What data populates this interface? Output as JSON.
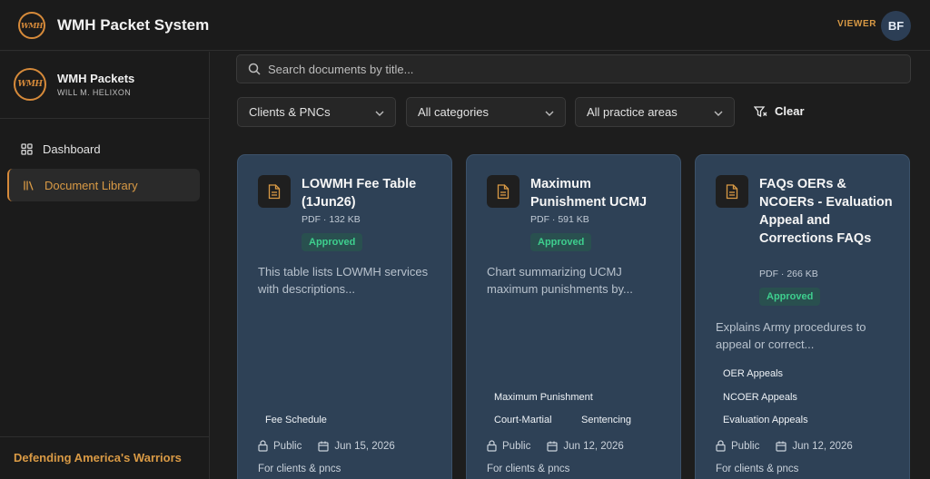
{
  "header": {
    "logo_text": "WMH",
    "app_title": "WMH Packet System",
    "role": "VIEWER",
    "avatar_initials": "BF"
  },
  "sidebar": {
    "brand_name": "WMH Packets",
    "brand_sub": "WILL M. HELIXON",
    "items": [
      {
        "label": "Dashboard",
        "icon": "grid-icon",
        "active": false
      },
      {
        "label": "Document Library",
        "icon": "library-icon",
        "active": true
      }
    ],
    "tagline": "Defending America's Warriors"
  },
  "search": {
    "placeholder": "Search documents by title..."
  },
  "filters": {
    "audience": "Clients & PNCs",
    "category": "All categories",
    "practice_area": "All practice areas",
    "clear_label": "Clear"
  },
  "documents": [
    {
      "title": "LOWMH Fee Table (1Jun26)",
      "meta": "PDF · 132 KB",
      "status": "Approved",
      "description": "This table lists LOWMH services with descriptions...",
      "tags": [
        "Fee Schedule"
      ],
      "visibility": "Public",
      "date": "Jun 15, 2026",
      "audience": "For clients & pncs"
    },
    {
      "title": "Maximum Punishment UCMJ",
      "meta": "PDF · 591 KB",
      "status": "Approved",
      "description": "Chart summarizing UCMJ maximum punishments by...",
      "tags": [
        "Maximum Punishment",
        "Court-Martial",
        "Sentencing"
      ],
      "visibility": "Public",
      "date": "Jun 12, 2026",
      "audience": "For clients & pncs"
    },
    {
      "title": "FAQs OERs & NCOERs - Evaluation Appeal and Corrections FAQs",
      "meta": "PDF · 266 KB",
      "status": "Approved",
      "description": "Explains Army procedures to appeal or correct...",
      "tags": [
        "OER Appeals",
        "NCOER Appeals",
        "Evaluation Appeals"
      ],
      "visibility": "Public",
      "date": "Jun 12, 2026",
      "audience": "For clients & pncs"
    }
  ],
  "colors": {
    "accent": "#d99a45",
    "card_bg": "#2e4156",
    "approved": "#3ecf8e",
    "page_bg": "#1d1d1d"
  }
}
